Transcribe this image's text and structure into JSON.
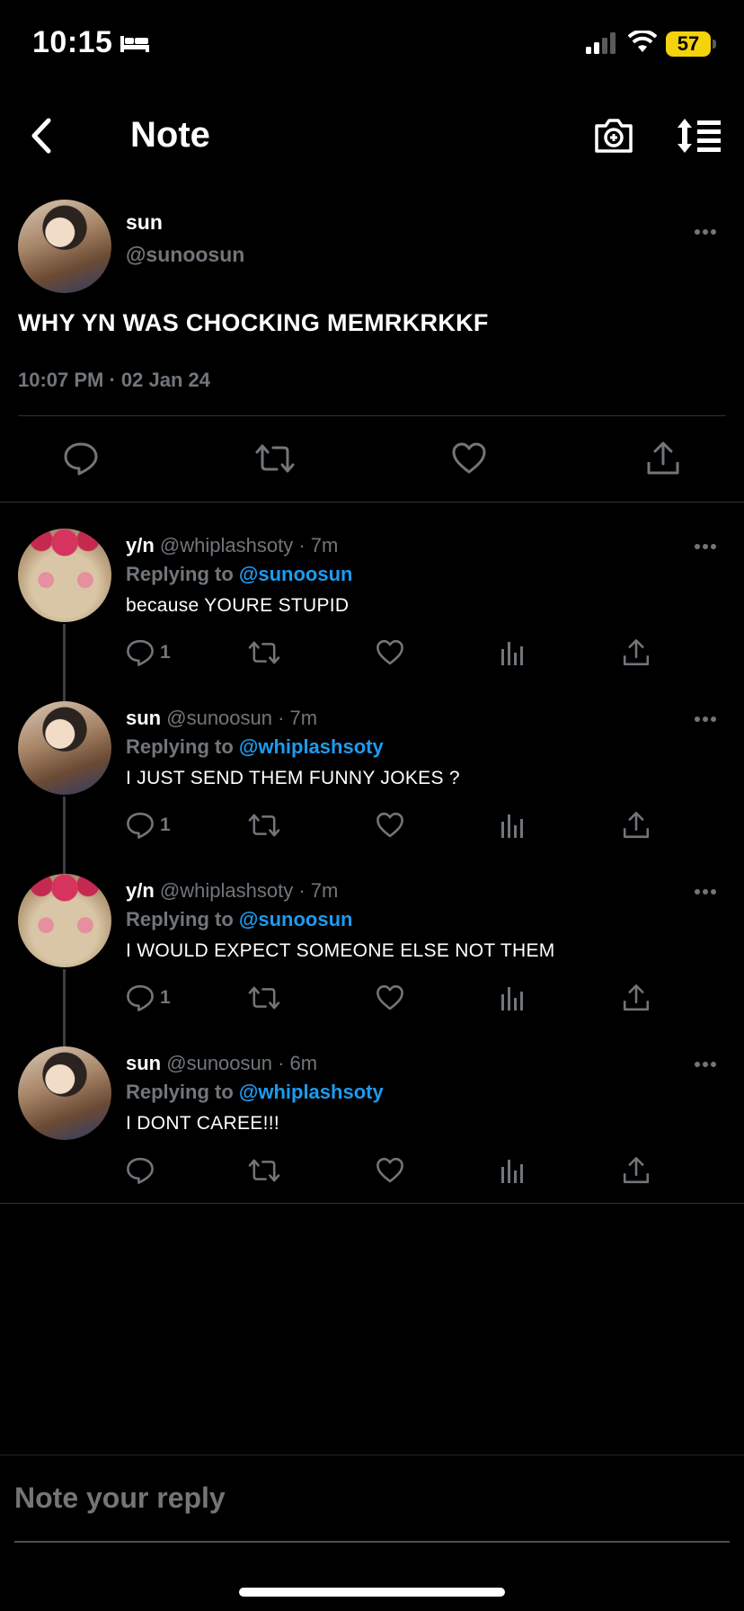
{
  "status_bar": {
    "time": "10:15",
    "sleep_icon": "bed-icon",
    "battery": "57"
  },
  "header": {
    "title": "Note",
    "back_icon": "chevron-left-icon",
    "camera_icon": "camera-plus-icon",
    "sort_icon": "sort-lines-icon"
  },
  "post": {
    "name": "sun",
    "handle": "@sunoosun",
    "text": "WHY YN WAS CHOCKING MEMRKRKKF",
    "meta": "10:07 PM · 02 Jan 24"
  },
  "replies": [
    {
      "name": "y/n",
      "handle": "@whiplashsoty · 7m",
      "replying_prefix": "Replying to ",
      "replying_to": "@sunoosun",
      "text": "because YOURE STUPID",
      "reply_count": "1",
      "avatar": "cat"
    },
    {
      "name": "sun",
      "handle": "@sunoosun · 7m",
      "replying_prefix": "Replying to ",
      "replying_to": "@whiplashsoty",
      "text": "I JUST SEND THEM FUNNY JOKES ?",
      "reply_count": "1",
      "avatar": "sun"
    },
    {
      "name": "y/n",
      "handle": "@whiplashsoty · 7m",
      "replying_prefix": "Replying to ",
      "replying_to": "@sunoosun",
      "text": "I WOULD EXPECT SOMEONE ELSE NOT THEM",
      "reply_count": "1",
      "avatar": "cat"
    },
    {
      "name": "sun",
      "handle": "@sunoosun · 6m",
      "replying_prefix": "Replying to ",
      "replying_to": "@whiplashsoty",
      "text": "I DONT CAREE!!!",
      "reply_count": "",
      "avatar": "sun"
    }
  ],
  "composer": {
    "placeholder": "Note your reply"
  },
  "colors": {
    "background": "#000000",
    "mention": "#1d9bf0",
    "muted": "#71767b",
    "battery": "#f4d20c"
  }
}
